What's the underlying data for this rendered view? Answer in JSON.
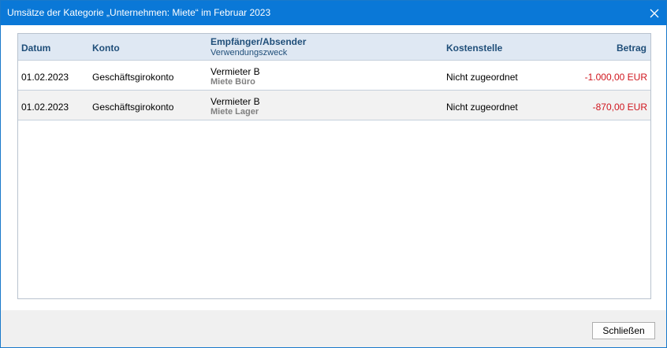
{
  "window": {
    "title": "Umsätze der Kategorie „Unternehmen: Miete“ im Februar 2023",
    "close_icon": "close-icon"
  },
  "table": {
    "columns": {
      "datum": "Datum",
      "konto": "Konto",
      "empfaenger": "Empfänger/Absender",
      "verwendungszweck": "Verwendungszweck",
      "kostenstelle": "Kostenstelle",
      "betrag": "Betrag"
    },
    "rows": [
      {
        "datum": "01.02.2023",
        "konto": "Geschäftsgirokonto",
        "empfaenger": "Vermieter B",
        "verwendungszweck": "Miete Büro",
        "kostenstelle": "Nicht zugeordnet",
        "betrag": "-1.000,00 EUR"
      },
      {
        "datum": "01.02.2023",
        "konto": "Geschäftsgirokonto",
        "empfaenger": "Vermieter B",
        "verwendungszweck": "Miete Lager",
        "kostenstelle": "Nicht zugeordnet",
        "betrag": "-870,00 EUR"
      }
    ]
  },
  "footer": {
    "close_button": "Schließen"
  },
  "colors": {
    "titlebar": "#0a78d7",
    "header_bg": "#dfe8f3",
    "header_text": "#1f4e79",
    "negative_amount": "#d0151d"
  }
}
